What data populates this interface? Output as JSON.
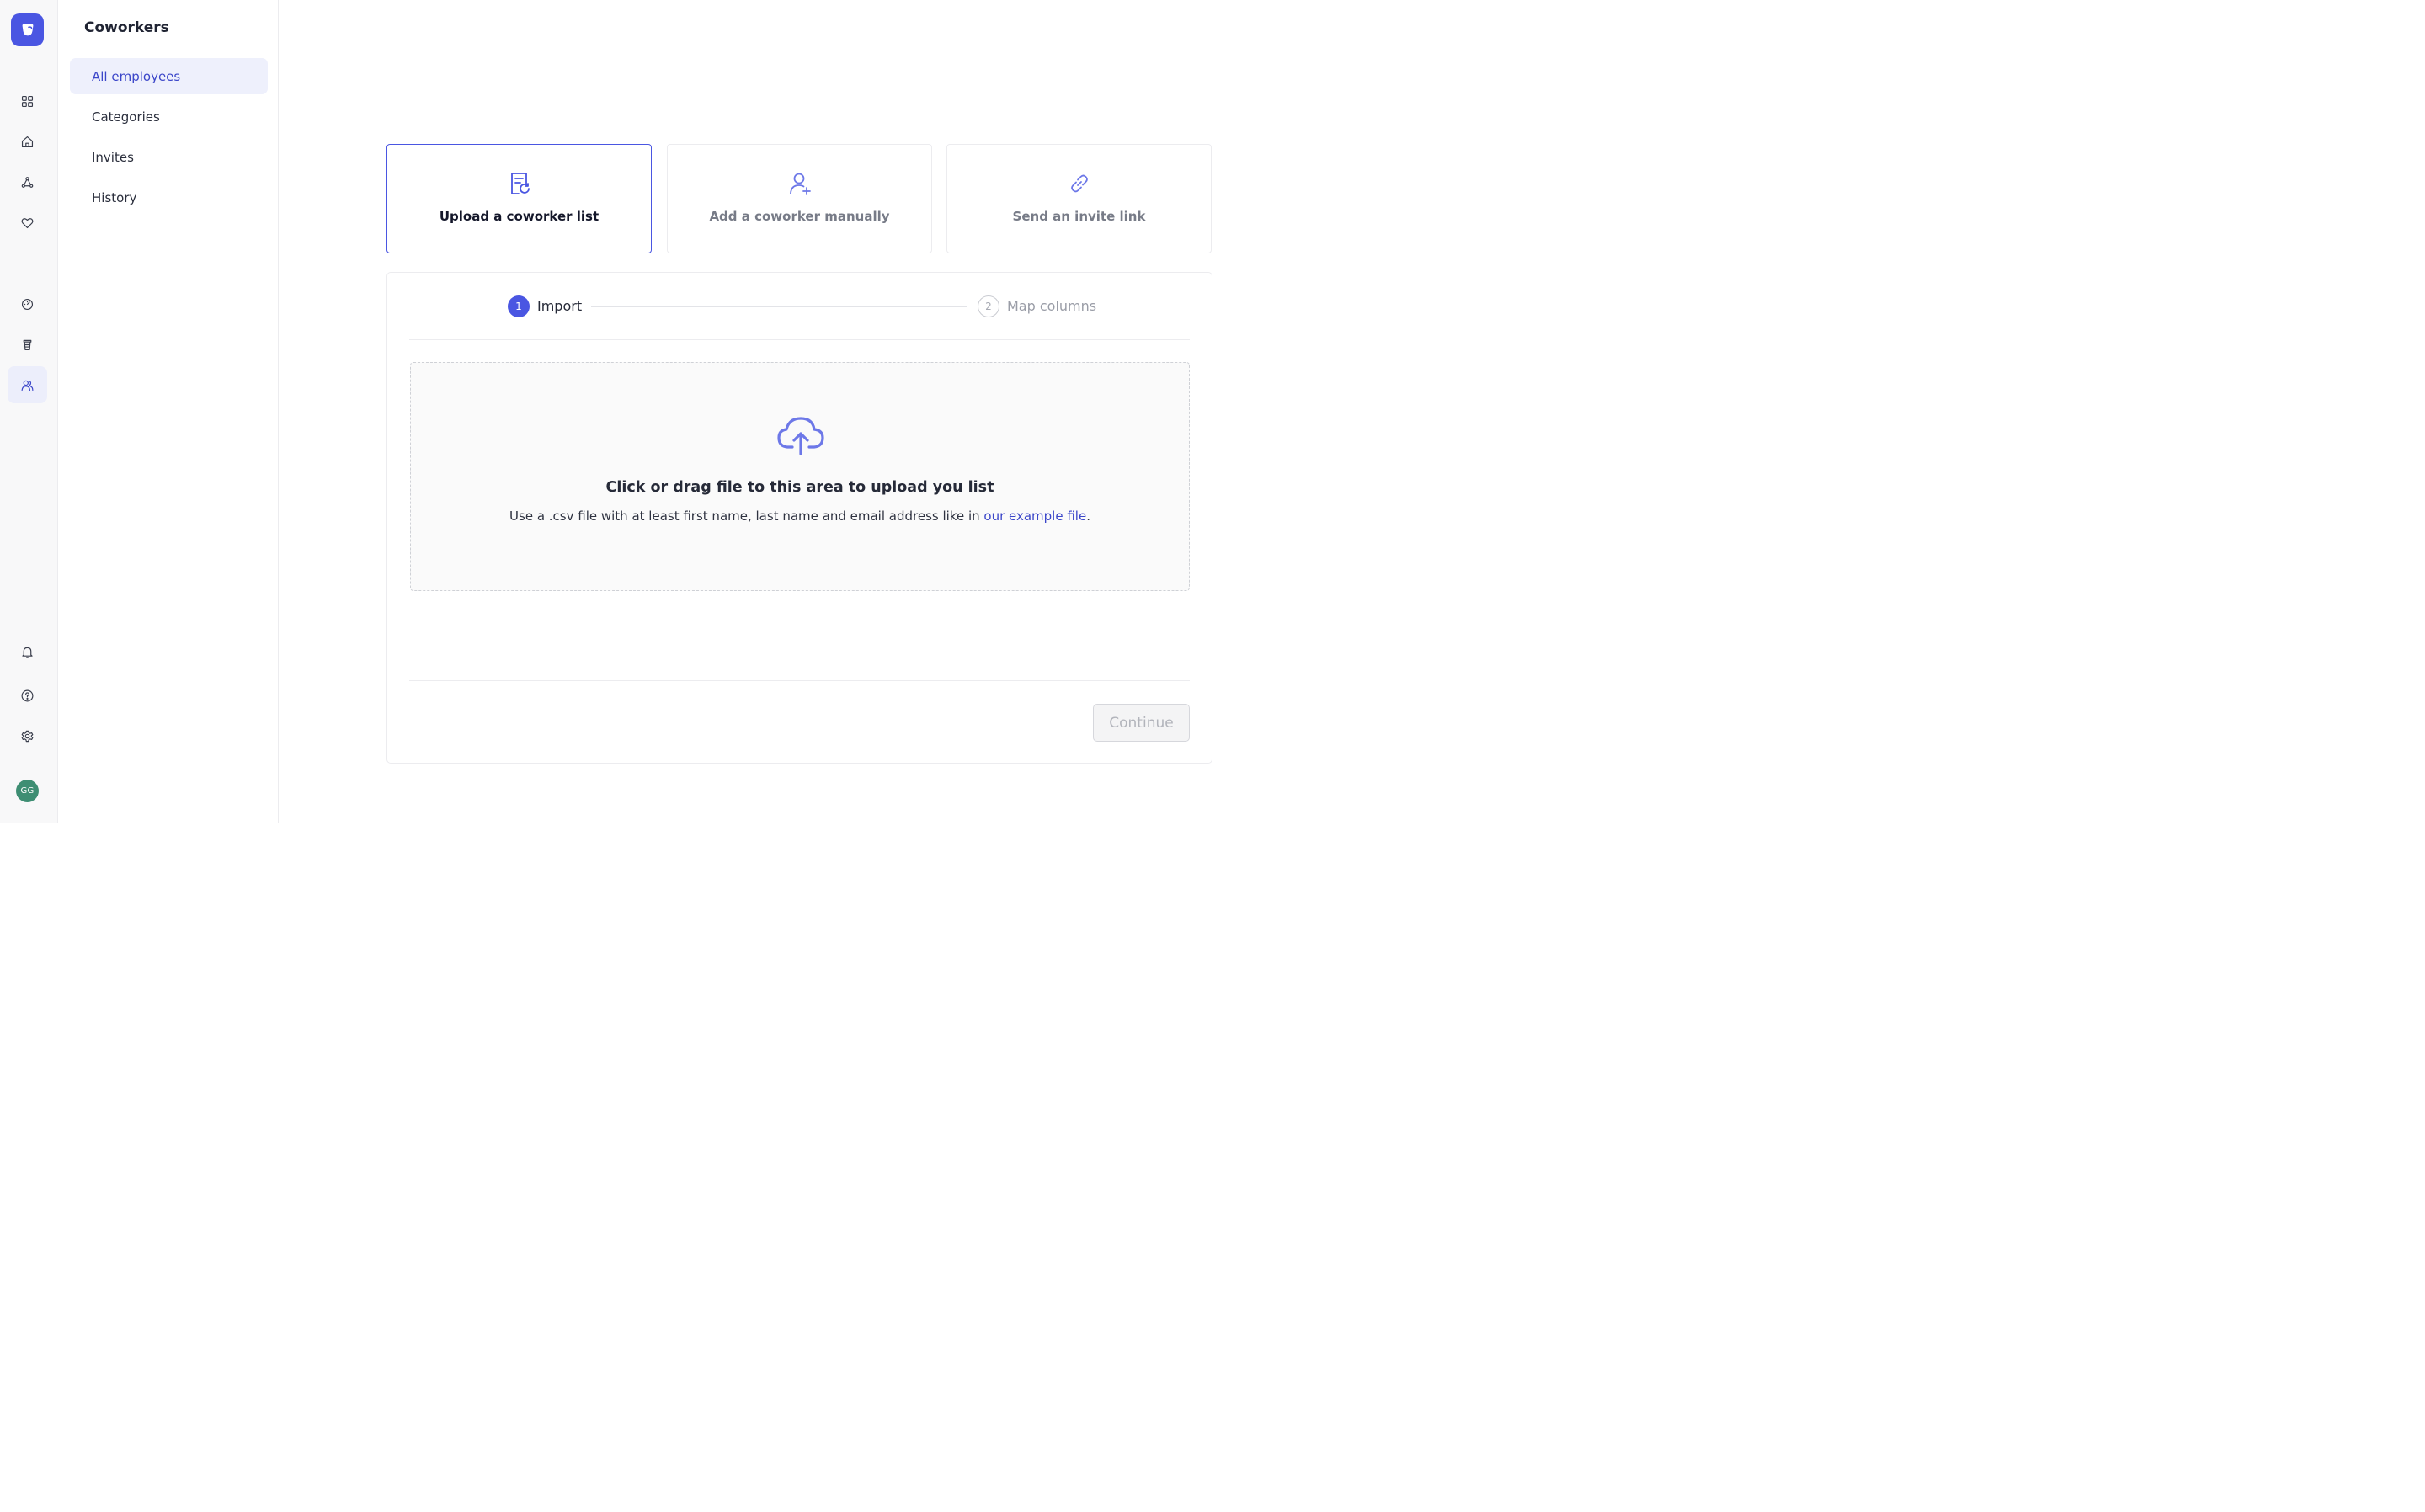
{
  "rail": {
    "icons": [
      "dashboard-icon",
      "home-icon",
      "integrations-icon",
      "heart-icon",
      "gauge-icon",
      "cup-icon",
      "coworkers-icon",
      "bell-icon",
      "help-icon",
      "settings-icon"
    ],
    "active": "coworkers-icon",
    "avatar_initials": "GG"
  },
  "sidebar": {
    "title": "Coworkers",
    "items": [
      {
        "label": "All employees",
        "active": true
      },
      {
        "label": "Categories",
        "active": false
      },
      {
        "label": "Invites",
        "active": false
      },
      {
        "label": "History",
        "active": false
      }
    ]
  },
  "options": [
    {
      "label": "Upload a coworker list",
      "icon": "upload-list-icon",
      "selected": true
    },
    {
      "label": "Add a coworker manually",
      "icon": "add-user-icon",
      "selected": false
    },
    {
      "label": "Send an invite link",
      "icon": "link-icon",
      "selected": false
    }
  ],
  "steps": [
    {
      "number": "1",
      "label": "Import",
      "active": true
    },
    {
      "number": "2",
      "label": "Map columns",
      "active": false
    }
  ],
  "dropzone": {
    "icon": "cloud-upload-icon",
    "title": "Click or drag file to this area to upload you list",
    "text_before": "Use a .csv file with at least first name, last name and email address like in ",
    "link_text": "our example file",
    "text_after": "."
  },
  "continue_label": "Continue",
  "colors": {
    "accent": "#4a56e2",
    "accent_text": "#3b46c9",
    "active_bg": "#eef0fc",
    "avatar": "#3e8e73"
  }
}
